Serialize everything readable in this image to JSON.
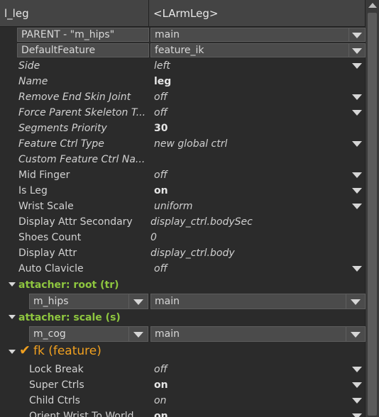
{
  "header": {
    "name": "l_leg",
    "type": "<LArmLeg>"
  },
  "props": [
    {
      "label": "PARENT - \"m_hips\"",
      "value": "main",
      "combo": true
    },
    {
      "label": "DefaultFeature",
      "value": "feature_ik",
      "combo": true
    },
    {
      "label": "Side",
      "value": "left",
      "label_italic": true,
      "value_italic": true,
      "arrow": true
    },
    {
      "label": "Name",
      "value": "leg",
      "label_italic": true,
      "value_bold": true
    },
    {
      "label": "Remove End Skin Joint",
      "value": "off",
      "label_italic": true,
      "value_italic": true,
      "arrow": true
    },
    {
      "label": "Force Parent Skeleton T...",
      "value": "off",
      "label_italic": true,
      "value_italic": true,
      "arrow": true
    },
    {
      "label": "Segments Priority",
      "value": "30",
      "label_italic": true,
      "value_bold": true
    },
    {
      "label": "Feature Ctrl Type",
      "value": "new global ctrl",
      "label_italic": true,
      "value_italic": true,
      "arrow": true
    },
    {
      "label": "Custom Feature Ctrl Na...",
      "value": "",
      "label_italic": true
    },
    {
      "label": "Mid Finger",
      "value": "off",
      "value_italic": true,
      "arrow": true
    },
    {
      "label": "Is Leg",
      "value": "on",
      "value_bold": true,
      "arrow": true
    },
    {
      "label": "Wrist Scale",
      "value": "uniform",
      "value_italic": true,
      "arrow": true
    },
    {
      "label": "Display Attr Secondary",
      "value": "display_ctrl.bodySec",
      "value_italic": true,
      "value_left": true
    },
    {
      "label": "Shoes Count",
      "value": "0",
      "value_italic": true,
      "value_left": true
    },
    {
      "label": "Display Attr",
      "value": "display_ctrl.body",
      "value_italic": true,
      "value_left": true
    },
    {
      "label": "Auto Clavicle",
      "value": "off",
      "value_italic": true,
      "arrow": true
    }
  ],
  "attacher_root": {
    "title": "attacher: root (tr)",
    "left": "m_hips",
    "right": "main"
  },
  "attacher_scale": {
    "title": "attacher: scale (s)",
    "left": "m_cog",
    "right": "main"
  },
  "fk": {
    "title": "fk (feature)",
    "check": "✔",
    "props": [
      {
        "label": "Lock Break",
        "value": "off",
        "value_italic": true,
        "arrow": true
      },
      {
        "label": "Super Ctrls",
        "value": "on",
        "value_bold": true,
        "arrow": true
      },
      {
        "label": "Child Ctrls",
        "value": "on",
        "value_italic": true,
        "arrow": true
      },
      {
        "label": "Orient Wrist To World",
        "value": "on",
        "value_bold": true,
        "arrow": true
      }
    ]
  }
}
